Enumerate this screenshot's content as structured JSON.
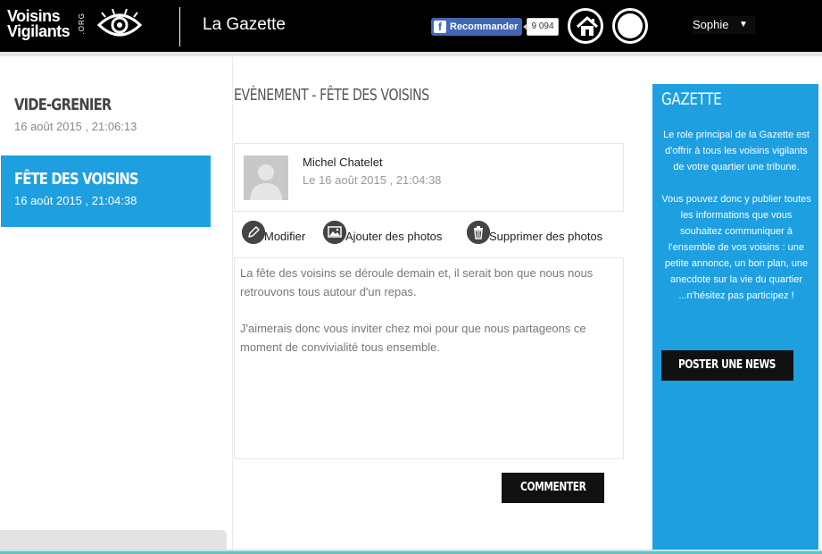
{
  "header": {
    "logo_line1": "Voisins",
    "logo_line2": "Vigilants",
    "logo_org": ".ORG",
    "app_title": "La Gazette",
    "fb_button_label": "Recommander",
    "fb_count": "9 094",
    "user_name": "Sophie",
    "caret": "▼"
  },
  "sidebar": {
    "items": [
      {
        "title": "VIDE-GRENIER",
        "date": "16 août 2015 , 21:06:13",
        "active": false
      },
      {
        "title": "FÊTE DES VOISINS",
        "date": "16 août 2015 , 21:04:38",
        "active": true
      }
    ]
  },
  "main": {
    "page_title": "EVÈNEMENT - FÊTE DES VOISINS",
    "author": {
      "name": "Michel Chatelet",
      "date": "Le 16 août 2015 , 21:04:38"
    },
    "actions": {
      "edit": "Modifier",
      "add_photos": "Ajouter des photos",
      "delete_photos": "Supprimer des photos"
    },
    "content": {
      "paragraph1": "La fête des voisins se déroule demain et, il serait bon que nous nous retrouvons tous autour d'un repas.",
      "paragraph2": "J'aimerais donc vous inviter chez moi pour que nous partageons ce moment de convivialité tous ensemble."
    },
    "comment_button": "COMMENTER"
  },
  "gazette": {
    "title": "GAZETTE",
    "paragraph1": "Le role principal de la Gazette est d'offrir à tous les voisins vigilants de votre quartier une tribune.",
    "paragraph2": "Vous pouvez donc y publier toutes les informations que vous souhaitez communiquer à l'ensemble de vos voisins : une petite annonce, un bon plan, une anecdote sur la vie du quartier ...n'hésitez pas participez !",
    "post_button": "POSTER UNE NEWS"
  },
  "colors": {
    "accent": "#1e9fe0",
    "header_bg": "#000000",
    "button_dark": "#111111",
    "facebook": "#4267b2"
  },
  "icons": [
    "eye-logo-icon",
    "facebook-icon",
    "home-icon",
    "profile-icon",
    "pencil-icon",
    "image-icon",
    "trash-icon",
    "avatar-placeholder-icon"
  ]
}
